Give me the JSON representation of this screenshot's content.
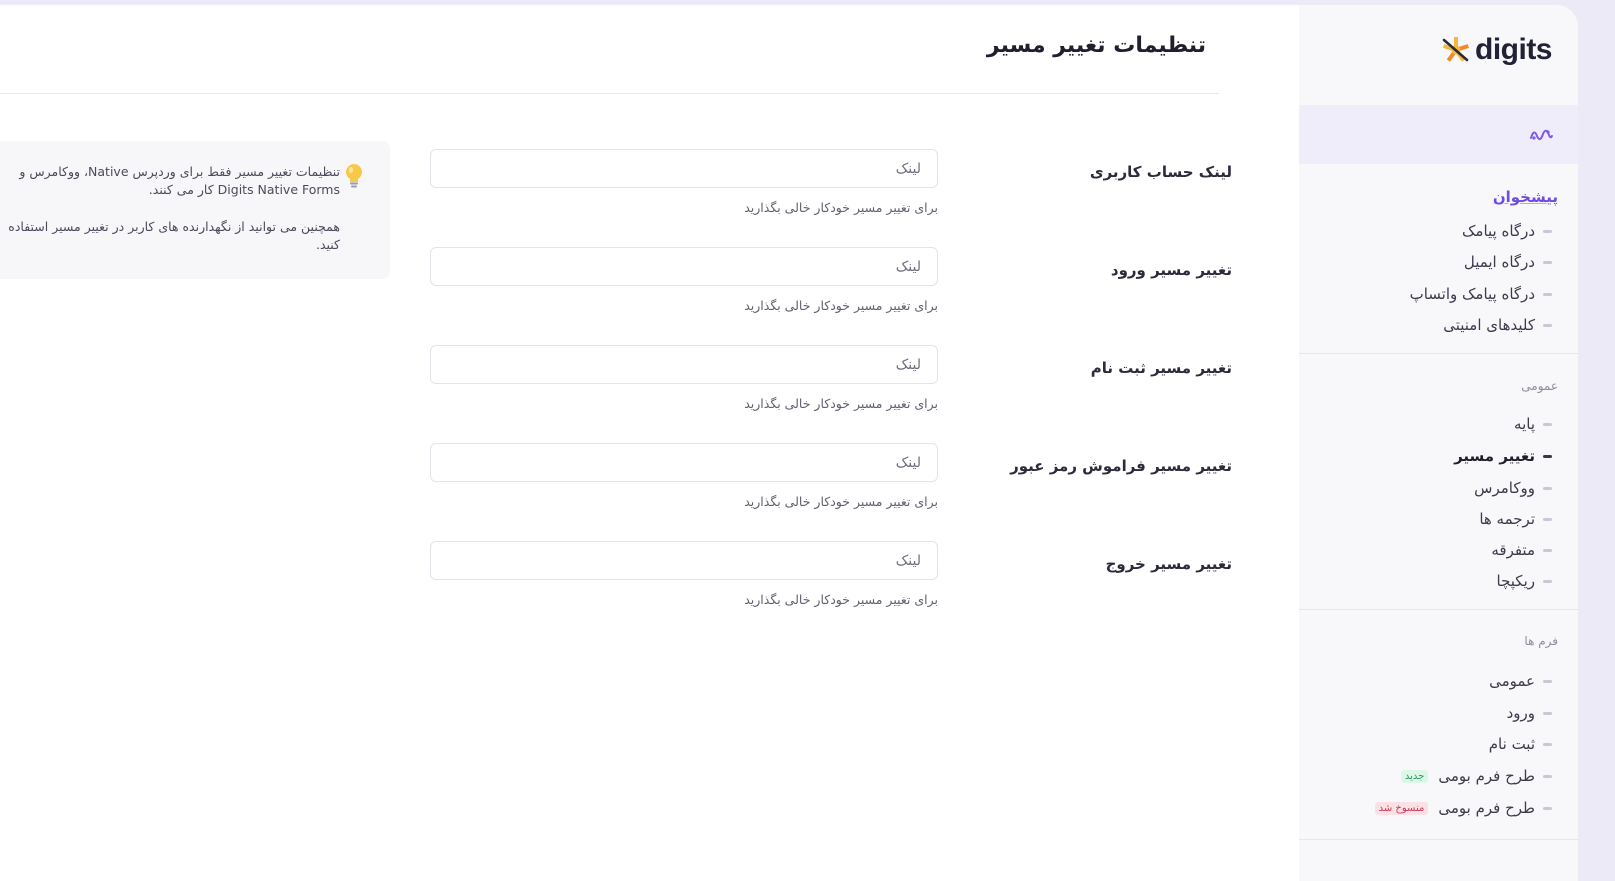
{
  "colors": {
    "accent": "#6d4ce3",
    "logo_yellow": "#f6b73c",
    "logo_orange": "#f18a2c"
  },
  "sidebar": {
    "logo_text": "digits",
    "quick_icon": "activity-icon",
    "top_link": "پیشخوان",
    "gateway_items": [
      {
        "label": "درگاه پیامک"
      },
      {
        "label": "درگاه ایمیل"
      },
      {
        "label": "درگاه پیامک واتساپ"
      },
      {
        "label": "کلیدهای امنیتی"
      }
    ],
    "general_section_label": "عمومی",
    "general_items": [
      {
        "label": "پایه"
      },
      {
        "label": "تغییر مسیر"
      },
      {
        "label": "ووکامرس"
      },
      {
        "label": "ترجمه ها"
      },
      {
        "label": "متفرقه"
      },
      {
        "label": "ریکپچا"
      }
    ],
    "active_item": "تغییر مسیر",
    "forms_section_label": "فرم ها",
    "forms_items": [
      {
        "label": "عمومی"
      },
      {
        "label": "ورود"
      },
      {
        "label": "ثبت نام"
      },
      {
        "label": "طرح فرم بومی",
        "badge": "جدید"
      },
      {
        "label": "طرح فرم بومی",
        "badge": "منسوخ شد"
      }
    ]
  },
  "main": {
    "title": "تنظیمات تغییر مسیر",
    "fields": [
      {
        "label": "لینک حساب کاربری",
        "placeholder": "لینک",
        "help": "برای تغییر مسیر خودکار خالی بگذارید"
      },
      {
        "label": "تغییر مسیر ورود",
        "placeholder": "لینک",
        "help": "برای تغییر مسیر خودکار خالی بگذارید"
      },
      {
        "label": "تغییر مسیر ثبت نام",
        "placeholder": "لینک",
        "help": "برای تغییر مسیر خودکار خالی بگذارید"
      },
      {
        "label": "تغییر مسیر فراموش رمز عبور",
        "placeholder": "لینک",
        "help": "برای تغییر مسیر خودکار خالی بگذارید"
      },
      {
        "label": "تغییر مسیر خروج",
        "placeholder": "لینک",
        "help": "برای تغییر مسیر خودکار خالی بگذارید"
      }
    ],
    "info": {
      "icon": "lightbulb-icon",
      "paragraph_1": "تنظیمات تغییر مسیر فقط برای وردپرس Native، ووکامرس و Digits Native Forms کار می کنند.",
      "paragraph_2": "همچنین می توانید از نگهدارنده های کاربر در تغییر مسیر استفاده کنید."
    }
  }
}
